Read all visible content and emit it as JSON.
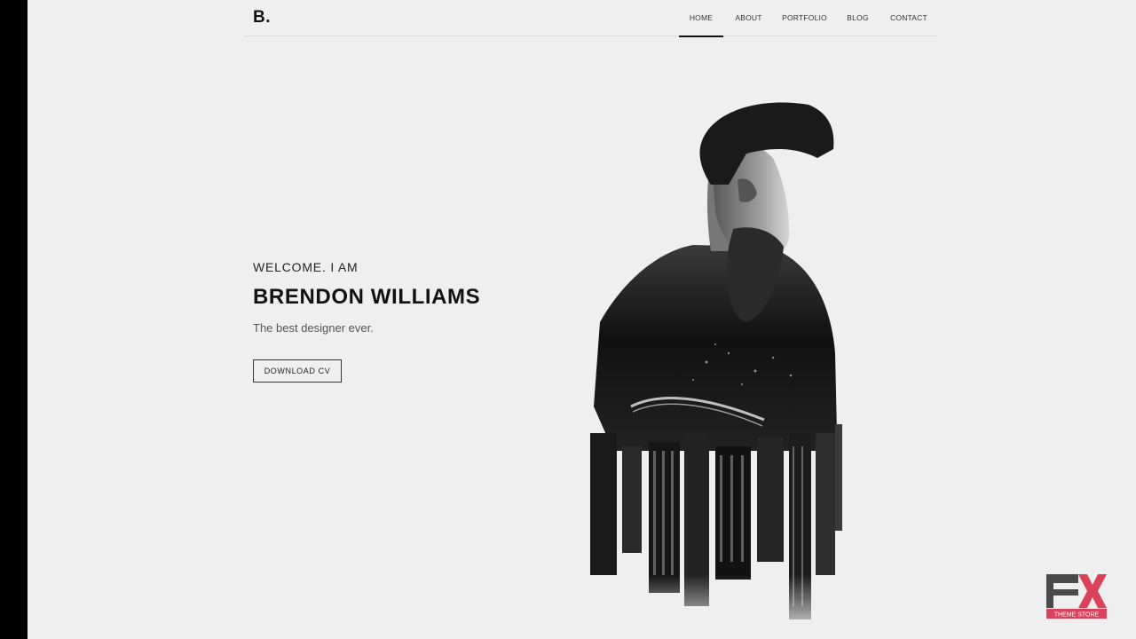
{
  "brand": {
    "logo_text": "B."
  },
  "nav": {
    "items": [
      {
        "label": "HOME",
        "active": true
      },
      {
        "label": "ABOUT",
        "active": false
      },
      {
        "label": "PORTFOLIO",
        "active": false
      },
      {
        "label": "BLOG",
        "active": false
      },
      {
        "label": "CONTACT",
        "active": false
      }
    ]
  },
  "hero": {
    "greeting": "WELCOME. I AM",
    "name": "BRENDON WILLIAMS",
    "tagline": "The best designer ever.",
    "cta_label": "DOWNLOAD CV"
  },
  "watermark": {
    "main": "FX",
    "sub": "THEME STORE",
    "accent_color": "#d9425a"
  },
  "colors": {
    "page_background": "#efefef",
    "text_primary": "#111111",
    "outer_frame": "#000000"
  }
}
